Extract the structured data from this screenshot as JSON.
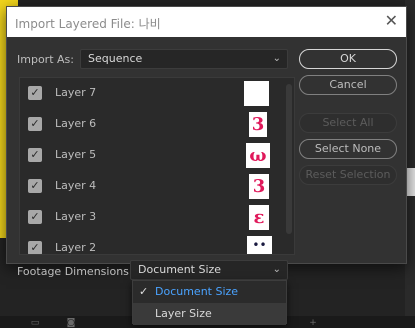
{
  "dialog": {
    "title": "Import Layered File: 나비",
    "close_glyph": "✕"
  },
  "import_as": {
    "label": "Import As:",
    "value": "Sequence"
  },
  "layers": [
    {
      "name": "Layer 7",
      "checked": true,
      "thumb_glyph": ""
    },
    {
      "name": "Layer 6",
      "checked": true,
      "thumb_glyph": "3"
    },
    {
      "name": "Layer 5",
      "checked": true,
      "thumb_glyph": "ω"
    },
    {
      "name": "Layer 4",
      "checked": true,
      "thumb_glyph": "3"
    },
    {
      "name": "Layer 3",
      "checked": true,
      "thumb_glyph": "ε"
    },
    {
      "name": "Layer 2",
      "checked": true,
      "thumb_glyph": "••"
    }
  ],
  "buttons": {
    "ok": "OK",
    "cancel": "Cancel",
    "select_all": "Select All",
    "select_none": "Select None",
    "reset_selection": "Reset Selection"
  },
  "footage_dimensions": {
    "label": "Footage Dimensions:",
    "value": "Document Size",
    "options": [
      "Document Size",
      "Layer Size"
    ]
  },
  "colors": {
    "thumb_ink": "#e0195b",
    "selected_option": "#4aa3ff",
    "background_accent": "#f2d51c"
  }
}
